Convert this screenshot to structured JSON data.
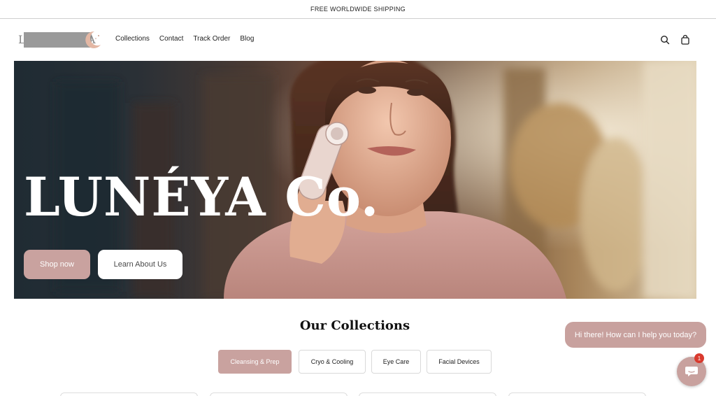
{
  "announcement": {
    "text": "FREE WORLDWIDE SHIPPING"
  },
  "header": {
    "logo_left_letter": "L",
    "logo_right_letter": "A",
    "nav": [
      "Collections",
      "Contact",
      "Track Order",
      "Blog"
    ],
    "icons": [
      "search-icon",
      "shopping-bag-icon"
    ]
  },
  "hero": {
    "title": "LUNÉYA Co.",
    "primary_button": "Shop now",
    "secondary_button": "Learn About Us"
  },
  "collections": {
    "title": "Our Collections",
    "tabs": [
      {
        "label": "Cleansing & Prep",
        "active": true
      },
      {
        "label": "Cryo & Cooling",
        "active": false
      },
      {
        "label": "Eye Care",
        "active": false
      },
      {
        "label": "Facial Devices",
        "active": false
      }
    ]
  },
  "chat": {
    "message": "Hi there! How can I help you today?",
    "badge_count": "1",
    "icon": "chat-icon"
  },
  "colors": {
    "accent": "#c9a29f",
    "badge": "#d93a2e"
  }
}
